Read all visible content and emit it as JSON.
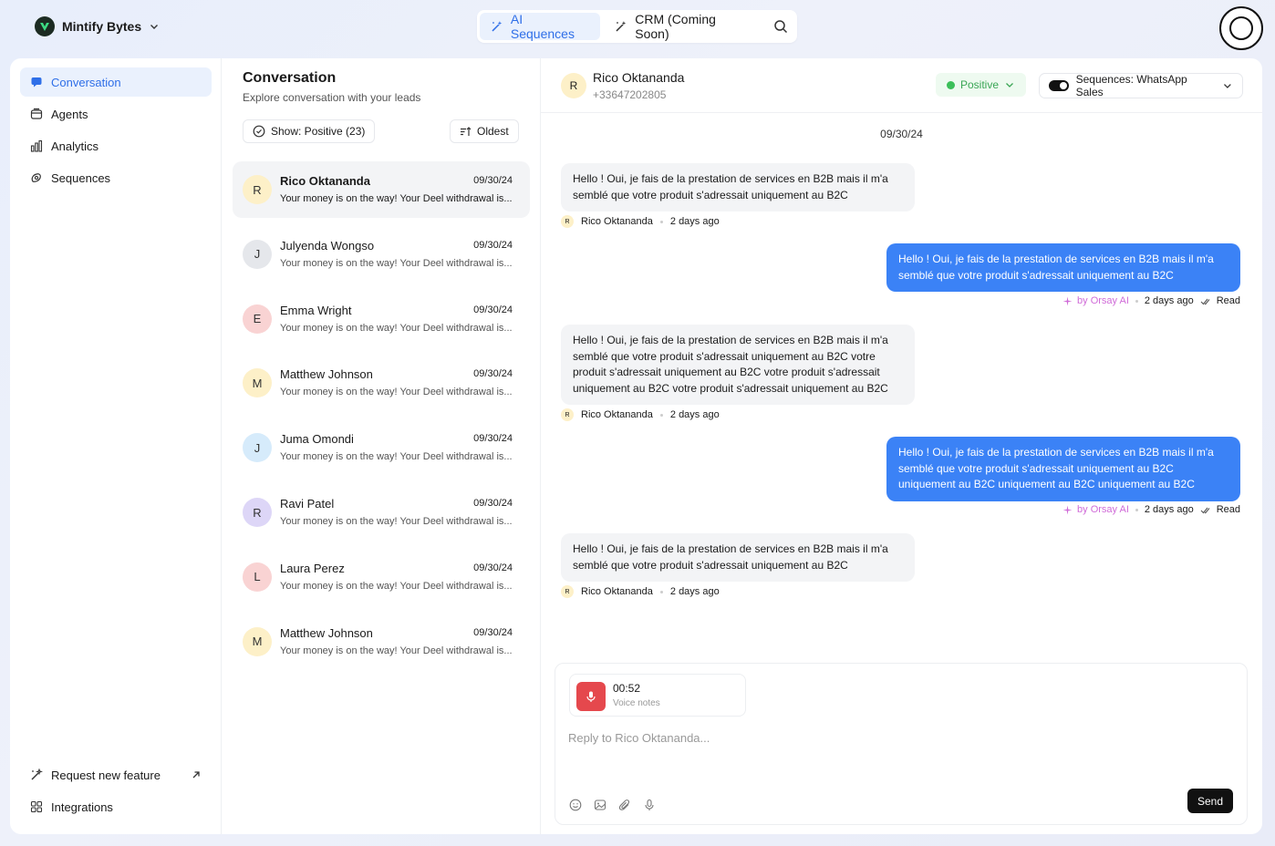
{
  "brand": {
    "name": "Mintify Bytes"
  },
  "topnav": {
    "tabs": [
      {
        "label": "AI Sequences"
      },
      {
        "label": "CRM (Coming Soon)"
      }
    ]
  },
  "sidebar": {
    "items": [
      {
        "label": "Conversation"
      },
      {
        "label": "Agents"
      },
      {
        "label": "Analytics"
      },
      {
        "label": "Sequences"
      }
    ],
    "footer": [
      {
        "label": "Request new feature"
      },
      {
        "label": "Integrations"
      }
    ]
  },
  "convlist": {
    "title": "Conversation",
    "subtitle": "Explore conversation with your leads",
    "filter_label": "Show: Positive (23)",
    "sort_label": "Oldest",
    "items": [
      {
        "initial": "R",
        "name": "Rico Oktananda",
        "date": "09/30/24",
        "preview": "Your money is on the way! Your Deel withdrawal is...",
        "color": "#fdf0c8"
      },
      {
        "initial": "J",
        "name": "Julyenda Wongso",
        "date": "09/30/24",
        "preview": "Your money is on the way! Your Deel withdrawal is...",
        "color": "#e5e7eb"
      },
      {
        "initial": "E",
        "name": "Emma Wright",
        "date": "09/30/24",
        "preview": "Your money is on the way! Your Deel withdrawal is...",
        "color": "#f9d3d3"
      },
      {
        "initial": "M",
        "name": "Matthew Johnson",
        "date": "09/30/24",
        "preview": "Your money is on the way! Your Deel withdrawal is...",
        "color": "#fdf0c8"
      },
      {
        "initial": "J",
        "name": "Juma Omondi",
        "date": "09/30/24",
        "preview": "Your money is on the way! Your Deel withdrawal is...",
        "color": "#d6ebfb"
      },
      {
        "initial": "R",
        "name": "Ravi Patel",
        "date": "09/30/24",
        "preview": "Your money is on the way! Your Deel withdrawal is...",
        "color": "#ddd6f7"
      },
      {
        "initial": "L",
        "name": "Laura Perez",
        "date": "09/30/24",
        "preview": "Your money is on the way! Your Deel withdrawal is...",
        "color": "#f9d3d3"
      },
      {
        "initial": "M",
        "name": "Matthew Johnson",
        "date": "09/30/24",
        "preview": "Your money is on the way! Your Deel withdrawal is...",
        "color": "#fdf0c8"
      }
    ]
  },
  "chat": {
    "contact": {
      "initial": "R",
      "name": "Rico Oktananda",
      "phone": "+33647202805"
    },
    "status": "Positive",
    "sequence": "Sequences: WhatsApp Sales",
    "date_separator": "09/30/24",
    "messages": [
      {
        "text": "Hello ! Oui, je fais de la prestation de services en B2B mais il m'a semblé que votre produit s'adressait uniquement au B2C",
        "sender": "Rico Oktananda",
        "initial": "R",
        "time": "2 days ago"
      },
      {
        "text": "Hello ! Oui, je fais de la prestation de services en B2B mais il m'a semblé que votre produit s'adressait uniquement au B2C",
        "by": "by Orsay AI",
        "time": "2 days ago",
        "receipt": "Read"
      },
      {
        "text": "Hello ! Oui, je fais de la prestation de services en B2B mais il m'a semblé que votre produit s'adressait uniquement au B2C votre produit s'adressait uniquement au B2C votre produit s'adressait uniquement au B2C votre produit s'adressait uniquement au B2C",
        "sender": "Rico Oktananda",
        "initial": "R",
        "time": "2 days ago"
      },
      {
        "text": "Hello ! Oui, je fais de la prestation de services en B2B mais il m'a semblé que votre produit s'adressait uniquement au B2C uniquement au B2C uniquement au B2C uniquement au B2C",
        "by": "by Orsay AI",
        "time": "2 days ago",
        "receipt": "Read"
      },
      {
        "text": "Hello ! Oui, je fais de la prestation de services en B2B mais il m'a semblé que votre produit s'adressait uniquement au B2C",
        "sender": "Rico Oktananda",
        "initial": "R",
        "time": "2 days ago"
      }
    ]
  },
  "composer": {
    "voice_time": "00:52",
    "voice_label": "Voice notes",
    "placeholder": "Reply to Rico Oktananda...",
    "send_label": "Send"
  },
  "colors": {
    "accent": "#2f6fe8",
    "outgoing_bubble": "#3b82f6",
    "positive": "#3cbf5a",
    "ai_label": "#d06bd8"
  }
}
